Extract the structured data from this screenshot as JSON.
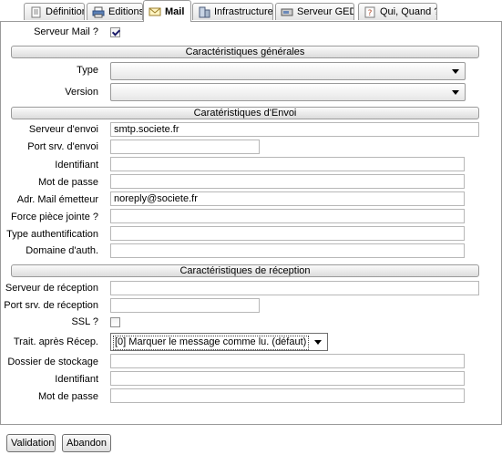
{
  "tabs": [
    {
      "label": "Définition",
      "icon": "document-icon"
    },
    {
      "label": "Editions",
      "icon": "printer-icon"
    },
    {
      "label": "Mail",
      "icon": "mail-icon"
    },
    {
      "label": "Infrastructure",
      "icon": "server-icon"
    },
    {
      "label": "Serveur GED",
      "icon": "drive-icon"
    },
    {
      "label": "Qui, Quand ?",
      "icon": "question-icon"
    }
  ],
  "active_tab": "Mail",
  "form": {
    "mail_server": {
      "label": "Serveur Mail ?",
      "checked": true
    },
    "general": {
      "title": "Caractéristiques générales",
      "type": {
        "label": "Type",
        "value": ""
      },
      "version": {
        "label": "Version",
        "value": ""
      }
    },
    "send": {
      "title": "Caratéristiques d'Envoi",
      "server": {
        "label": "Serveur d'envoi",
        "value": "smtp.societe.fr"
      },
      "port": {
        "label": "Port srv. d'envoi",
        "value": ""
      },
      "identifier": {
        "label": "Identifiant",
        "value": ""
      },
      "password": {
        "label": "Mot de passe",
        "value": ""
      },
      "sender": {
        "label": "Adr. Mail émetteur",
        "value": "noreply@societe.fr"
      },
      "force_attachment": {
        "label": "Force pièce jointe ?",
        "value": ""
      },
      "auth_type": {
        "label": "Type authentification",
        "value": ""
      },
      "auth_domain": {
        "label": "Domaine d'auth.",
        "value": ""
      }
    },
    "receive": {
      "title": "Caractéristiques de réception",
      "server": {
        "label": "Serveur de réception",
        "value": ""
      },
      "port": {
        "label": "Port srv. de réception",
        "value": ""
      },
      "ssl": {
        "label": "SSL ?",
        "checked": false
      },
      "after_receive": {
        "label": "Trait. après Récep.",
        "value": "[0] Marquer le message comme lu. (défaut)"
      },
      "storage_folder": {
        "label": "Dossier de stockage",
        "value": ""
      },
      "identifier": {
        "label": "Identifiant",
        "value": ""
      },
      "password": {
        "label": "Mot de passe",
        "value": ""
      }
    }
  },
  "buttons": {
    "validate": "Validation",
    "cancel": "Abandon"
  }
}
